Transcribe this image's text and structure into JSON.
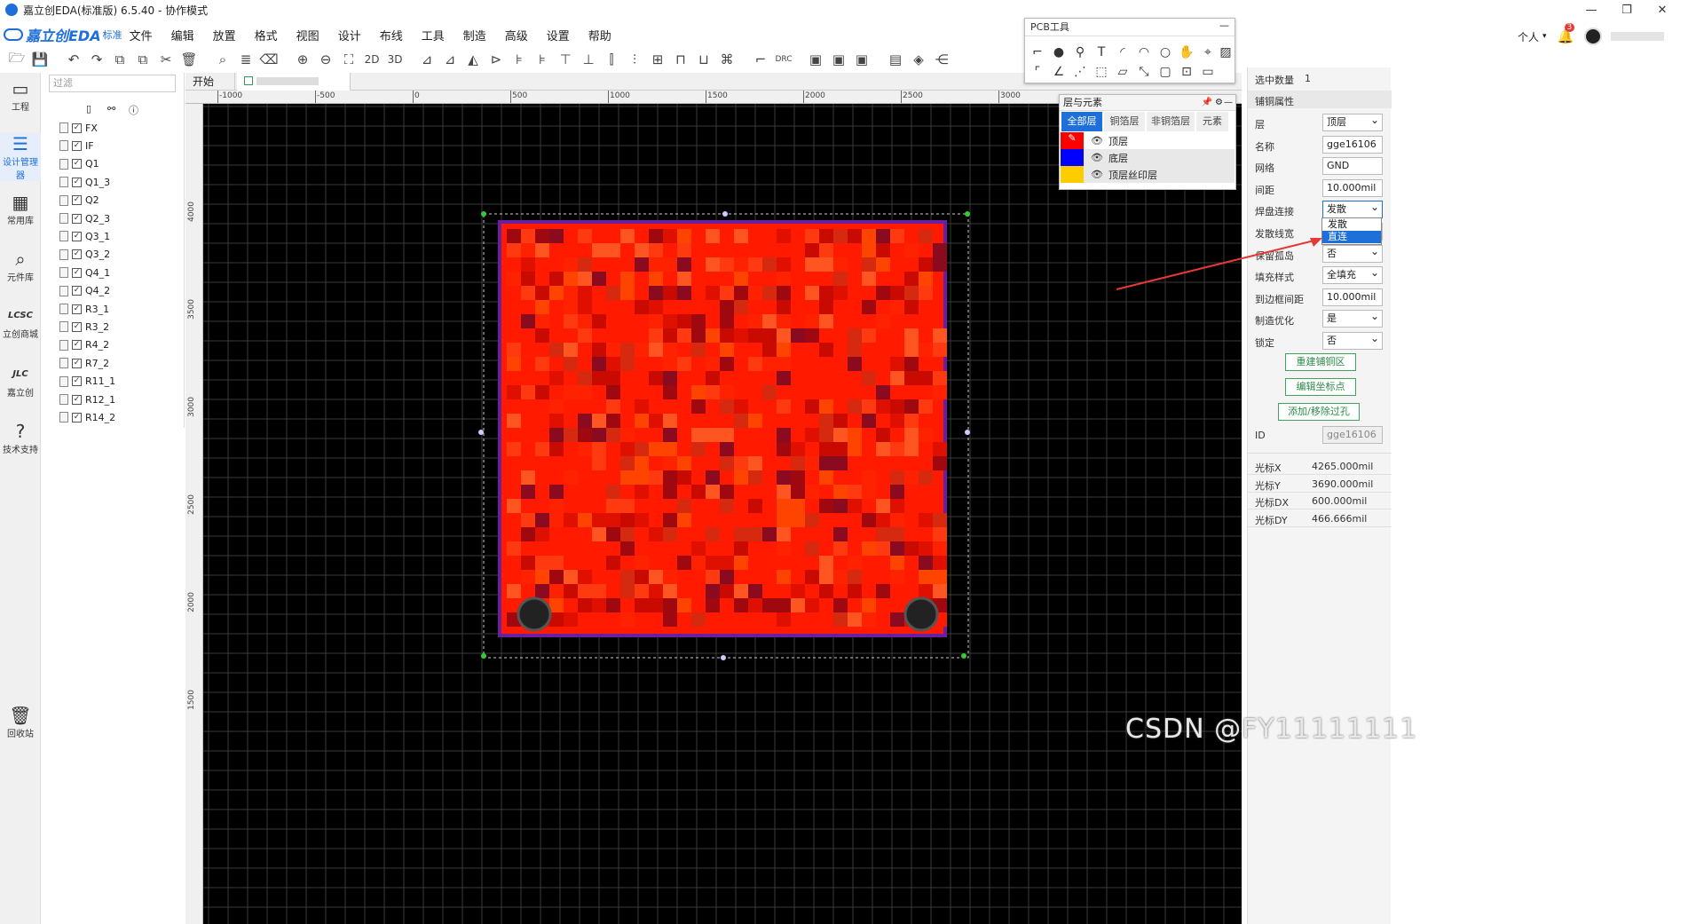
{
  "window": {
    "title": "嘉立创EDA(标准版) 6.5.40 - 协作模式"
  },
  "menu": {
    "brand": "嘉立创EDA",
    "brand_suffix": "标准",
    "items": [
      "文件",
      "编辑",
      "放置",
      "格式",
      "视图",
      "设计",
      "布线",
      "工具",
      "制造",
      "高级",
      "设置",
      "帮助"
    ]
  },
  "toolbar": {
    "label_2d": "2D",
    "label_3d": "3D",
    "label_drc": "DRC"
  },
  "user": {
    "menu_label": "个人",
    "notification_count": "3"
  },
  "left_rail": {
    "items": [
      {
        "label": "工程",
        "icon": "folder-icon"
      },
      {
        "label": "设计管理器",
        "icon": "design-manager-icon"
      },
      {
        "label": "常用库",
        "icon": "library-icon"
      },
      {
        "label": "元件库",
        "icon": "component-search-icon"
      },
      {
        "label": "立创商城",
        "icon": "lcsc-icon"
      },
      {
        "label": "嘉立创",
        "icon": "jlc-icon"
      },
      {
        "label": "技术支持",
        "icon": "support-icon"
      },
      {
        "label": "回收站",
        "icon": "trash-icon"
      }
    ]
  },
  "tree": {
    "filter_placeholder": "过滤",
    "items": [
      "FX",
      "IF",
      "Q1",
      "Q1_3",
      "Q2",
      "Q2_3",
      "Q3_1",
      "Q3_2",
      "Q4_1",
      "Q4_2",
      "R3_1",
      "R3_2",
      "R4_2",
      "R7_2",
      "R11_1",
      "R12_1",
      "R14_2"
    ]
  },
  "tabs": {
    "start": "开始"
  },
  "ruler": {
    "top": [
      "-1000",
      "-500",
      "0",
      "500",
      "1000",
      "1500",
      "2000",
      "2500",
      "3000"
    ],
    "left": [
      "4000",
      "3500",
      "3000",
      "2500",
      "2000",
      "1500"
    ]
  },
  "pcb_tools": {
    "title": "PCB工具"
  },
  "layers_panel": {
    "title": "层与元素",
    "tabs": [
      "全部层",
      "铜箔层",
      "非铜箔层",
      "元素"
    ],
    "rows": [
      {
        "name": "顶层",
        "color": "#ff0000"
      },
      {
        "name": "底层",
        "color": "#0000ff"
      },
      {
        "name": "顶层丝印层",
        "color": "#ffcc00"
      }
    ]
  },
  "properties": {
    "selected_label": "选中数量",
    "selected_count": "1",
    "section_title": "铺铜属性",
    "fields": [
      {
        "label": "层",
        "value": "顶层",
        "type": "select"
      },
      {
        "label": "名称",
        "value": "gge16106",
        "type": "text"
      },
      {
        "label": "网络",
        "value": "GND",
        "type": "text"
      },
      {
        "label": "间距",
        "value": "10.000mil",
        "type": "text"
      },
      {
        "label": "焊盘连接",
        "value": "发散",
        "type": "select"
      },
      {
        "label": "发散线宽",
        "value": "",
        "type": "text"
      },
      {
        "label": "保留孤岛",
        "value": "否",
        "type": "select"
      },
      {
        "label": "填充样式",
        "value": "全填充",
        "type": "select"
      },
      {
        "label": "到边框间距",
        "value": "10.000mil",
        "type": "text"
      },
      {
        "label": "制造优化",
        "value": "是",
        "type": "select"
      },
      {
        "label": "锁定",
        "value": "否",
        "type": "select"
      }
    ],
    "buttons": [
      "重建铺铜区",
      "编辑坐标点",
      "添加/移除过孔"
    ],
    "id_label": "ID",
    "id_value": "gge16106",
    "dropdown_options": [
      "发散",
      "直连"
    ],
    "dropdown_highlight": "直连",
    "cursor": [
      {
        "label": "光标X",
        "value": "4265.000mil"
      },
      {
        "label": "光标Y",
        "value": "3690.000mil"
      },
      {
        "label": "光标DX",
        "value": "600.000mil"
      },
      {
        "label": "光标DY",
        "value": "466.666mil"
      }
    ]
  },
  "watermark": "CSDN @FY11111111",
  "colors": {
    "accent": "#1e6fd9",
    "copper_top": "#ff0000",
    "board_outline": "#6a1fa0",
    "canvas_bg": "#000000"
  }
}
